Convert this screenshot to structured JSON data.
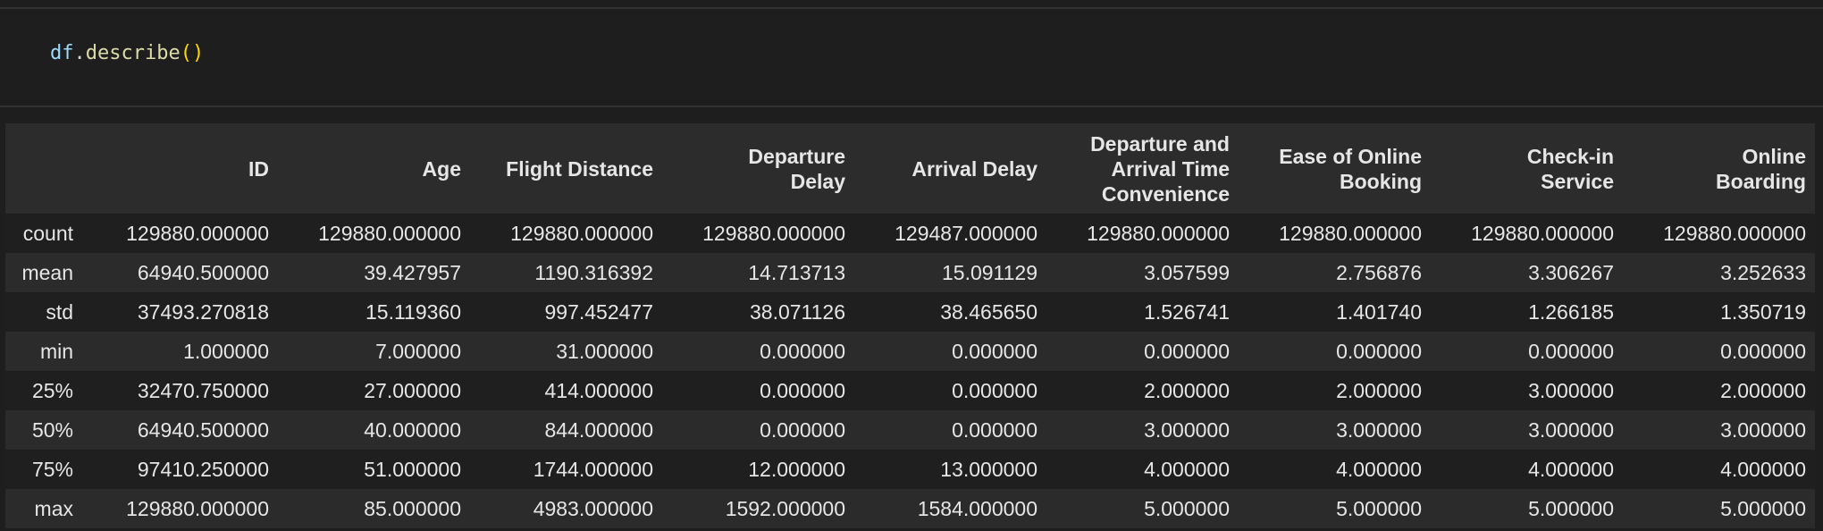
{
  "code": {
    "var": "df",
    "dot": ".",
    "fn": "describe",
    "open": "(",
    "close": ")"
  },
  "table": {
    "index_header": "",
    "columns": [
      [
        "ID"
      ],
      [
        "Age"
      ],
      [
        "Flight Distance"
      ],
      [
        "Departure",
        "Delay"
      ],
      [
        "Arrival Delay"
      ],
      [
        "Departure and",
        "Arrival Time",
        "Convenience"
      ],
      [
        "Ease of Online",
        "Booking"
      ],
      [
        "Check-in",
        "Service"
      ],
      [
        "Online",
        "Boarding"
      ]
    ],
    "rows": [
      {
        "label": "count",
        "values": [
          "129880.000000",
          "129880.000000",
          "129880.000000",
          "129880.000000",
          "129487.000000",
          "129880.000000",
          "129880.000000",
          "129880.000000",
          "129880.000000"
        ]
      },
      {
        "label": "mean",
        "values": [
          "64940.500000",
          "39.427957",
          "1190.316392",
          "14.713713",
          "15.091129",
          "3.057599",
          "2.756876",
          "3.306267",
          "3.252633"
        ]
      },
      {
        "label": "std",
        "values": [
          "37493.270818",
          "15.119360",
          "997.452477",
          "38.071126",
          "38.465650",
          "1.526741",
          "1.401740",
          "1.266185",
          "1.350719"
        ]
      },
      {
        "label": "min",
        "values": [
          "1.000000",
          "7.000000",
          "31.000000",
          "0.000000",
          "0.000000",
          "0.000000",
          "0.000000",
          "0.000000",
          "0.000000"
        ]
      },
      {
        "label": "25%",
        "values": [
          "32470.750000",
          "27.000000",
          "414.000000",
          "0.000000",
          "0.000000",
          "2.000000",
          "2.000000",
          "3.000000",
          "2.000000"
        ]
      },
      {
        "label": "50%",
        "values": [
          "64940.500000",
          "40.000000",
          "844.000000",
          "0.000000",
          "0.000000",
          "3.000000",
          "3.000000",
          "3.000000",
          "3.000000"
        ]
      },
      {
        "label": "75%",
        "values": [
          "97410.250000",
          "51.000000",
          "1744.000000",
          "12.000000",
          "13.000000",
          "4.000000",
          "4.000000",
          "4.000000",
          "4.000000"
        ]
      },
      {
        "label": "max",
        "values": [
          "129880.000000",
          "85.000000",
          "4983.000000",
          "1592.000000",
          "1584.000000",
          "5.000000",
          "5.000000",
          "5.000000",
          "5.000000"
        ]
      }
    ]
  },
  "colors": {
    "background": "#1e1e1e",
    "header_row": "#2c2c2c",
    "row_odd": "#1f1f1f",
    "row_even": "#2b2b2b",
    "text": "#e6e6e6"
  }
}
